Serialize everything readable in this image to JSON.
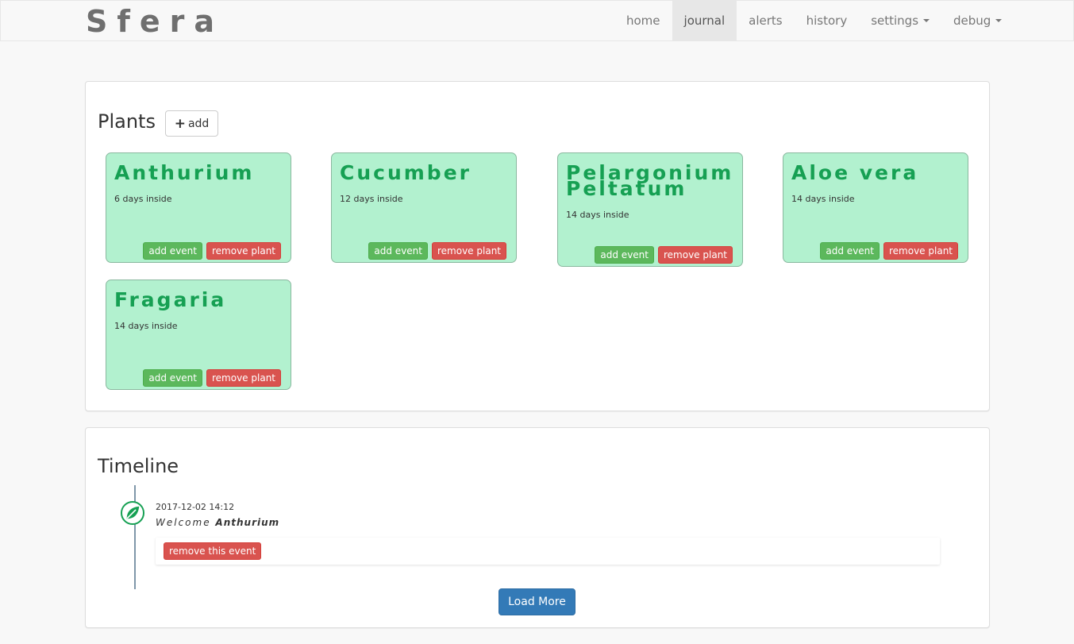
{
  "brand": "Sfera",
  "nav": {
    "home": "home",
    "journal": "journal",
    "alerts": "alerts",
    "history": "history",
    "settings": "settings",
    "debug": "debug"
  },
  "plants": {
    "title": "Plants",
    "add_label": "add",
    "add_event_label": "add event",
    "remove_plant_label": "remove plant",
    "items": [
      {
        "name": "Anthurium",
        "days": "6 days inside"
      },
      {
        "name": "Cucumber",
        "days": "12 days inside"
      },
      {
        "name": "Pelargonium Peltatum",
        "days": "14 days inside"
      },
      {
        "name": "Aloe vera",
        "days": "14 days inside"
      },
      {
        "name": "Fragaria",
        "days": "14 days inside"
      }
    ]
  },
  "timeline": {
    "title": "Timeline",
    "events": [
      {
        "date": "2017-12-02 14:12",
        "prefix": "Welcome",
        "plant": "Anthurium",
        "remove_label": "remove this event"
      }
    ],
    "load_more": "Load More"
  },
  "colors": {
    "card_bg": "#b2f1cf",
    "plant_name": "#16a053",
    "success": "#5cb85c",
    "danger": "#d9534f",
    "primary": "#337ab7"
  }
}
